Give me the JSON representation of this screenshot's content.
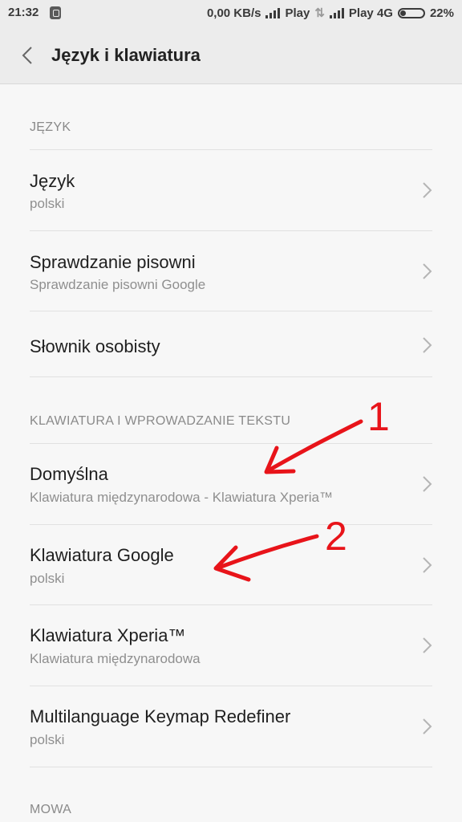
{
  "status_bar": {
    "time": "21:32",
    "speed": "0,00 KB/s",
    "carrier1": "Play",
    "carrier2": "Play 4G",
    "battery": "22%"
  },
  "header": {
    "title": "Język i klawiatura"
  },
  "sections": {
    "language": {
      "header": "JĘZYK"
    },
    "keyboard": {
      "header": "KLAWIATURA I WPROWADZANIE TEKSTU"
    },
    "speech": {
      "header": "MOWA"
    }
  },
  "items": {
    "language": {
      "title": "Język",
      "subtitle": "polski"
    },
    "spellcheck": {
      "title": "Sprawdzanie pisowni",
      "subtitle": "Sprawdzanie pisowni Google"
    },
    "dictionary": {
      "title": "Słownik osobisty"
    },
    "default": {
      "title": "Domyślna",
      "subtitle": "Klawiatura międzynarodowa - Klawiatura Xperia™"
    },
    "gboard": {
      "title": "Klawiatura Google",
      "subtitle": "polski"
    },
    "xperia": {
      "title": "Klawiatura Xperia™",
      "subtitle": "Klawiatura międzynarodowa"
    },
    "keymap": {
      "title": "Multilanguage Keymap Redefiner",
      "subtitle": "polski"
    }
  },
  "annotations": {
    "label1": "1",
    "label2": "2",
    "color": "#e8141a"
  }
}
